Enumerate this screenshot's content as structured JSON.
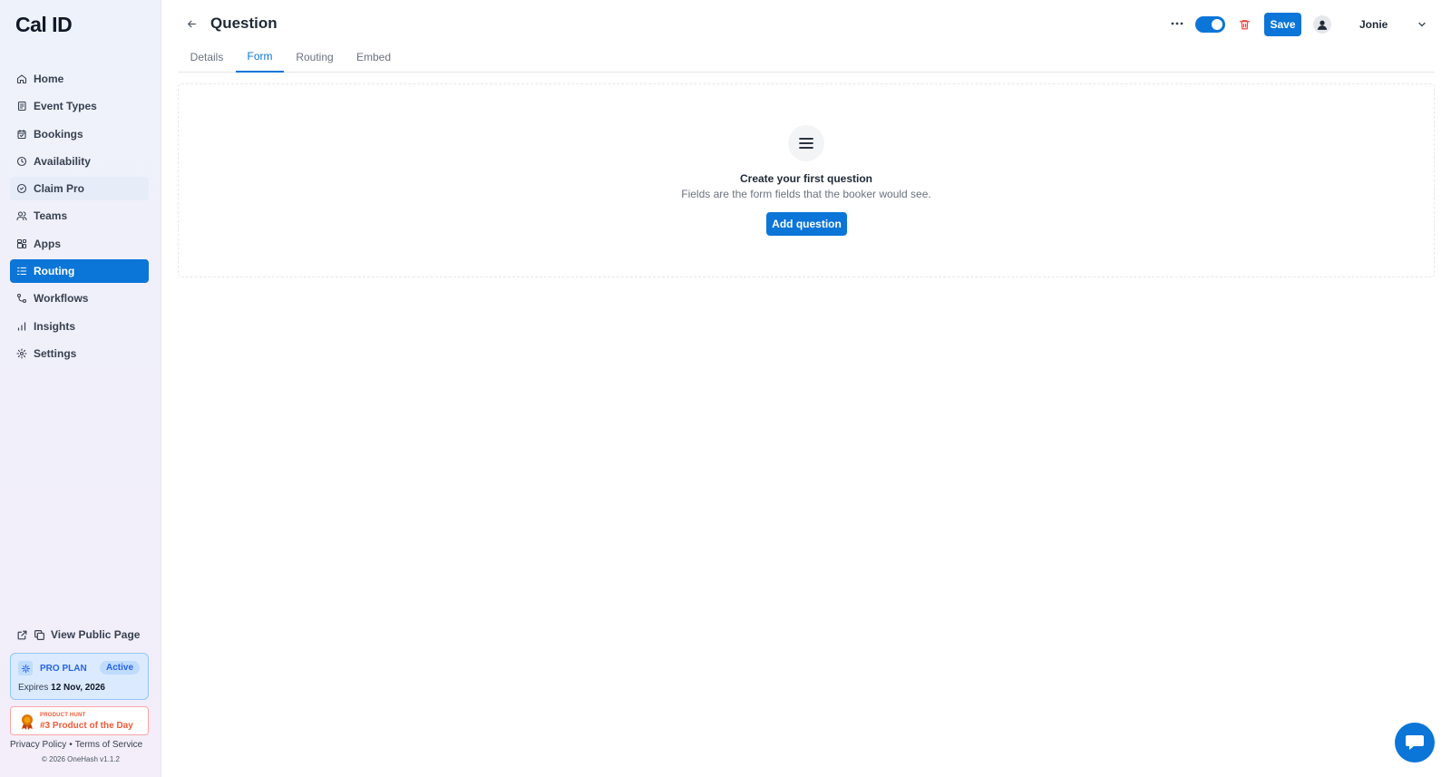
{
  "brand": {
    "logo_text": "Cal ID"
  },
  "sidebar": {
    "items": [
      {
        "label": "Home",
        "icon": "home-icon"
      },
      {
        "label": "Event Types",
        "icon": "event-types-icon"
      },
      {
        "label": "Bookings",
        "icon": "calendar-icon"
      },
      {
        "label": "Availability",
        "icon": "clock-icon"
      },
      {
        "label": "Claim Pro",
        "icon": "badge-icon"
      },
      {
        "label": "Teams",
        "icon": "users-icon"
      },
      {
        "label": "Apps",
        "icon": "apps-icon"
      },
      {
        "label": "Routing",
        "icon": "routing-icon",
        "active": true
      },
      {
        "label": "Workflows",
        "icon": "workflow-icon"
      },
      {
        "label": "Insights",
        "icon": "bar-chart-icon"
      },
      {
        "label": "Settings",
        "icon": "gear-icon"
      }
    ],
    "view_public": "View Public Page",
    "plan": {
      "name": "PRO PLAN",
      "status": "Active",
      "expires_label": "Expires",
      "expires_date": "12 Nov, 2026"
    },
    "product_hunt": {
      "small": "PRODUCT HUNT",
      "title": "#3 Product of the Day"
    },
    "footer": {
      "privacy": "Privacy Policy",
      "separator": "•",
      "terms": "Terms of Service",
      "copyright": "© 2026 OneHash v1.1.2"
    }
  },
  "header": {
    "title": "Question",
    "save_label": "Save",
    "user_name": "Jonie",
    "toggle_on": true
  },
  "tabs": [
    {
      "label": "Details"
    },
    {
      "label": "Form",
      "active": true
    },
    {
      "label": "Routing"
    },
    {
      "label": "Embed"
    }
  ],
  "empty_state": {
    "title": "Create your first question",
    "subtitle": "Fields are the form fields that the booker would see.",
    "button_label": "Add question"
  },
  "colors": {
    "accent": "#0b75d8",
    "danger": "#ef4444",
    "product_hunt": "#ef5a3a"
  }
}
